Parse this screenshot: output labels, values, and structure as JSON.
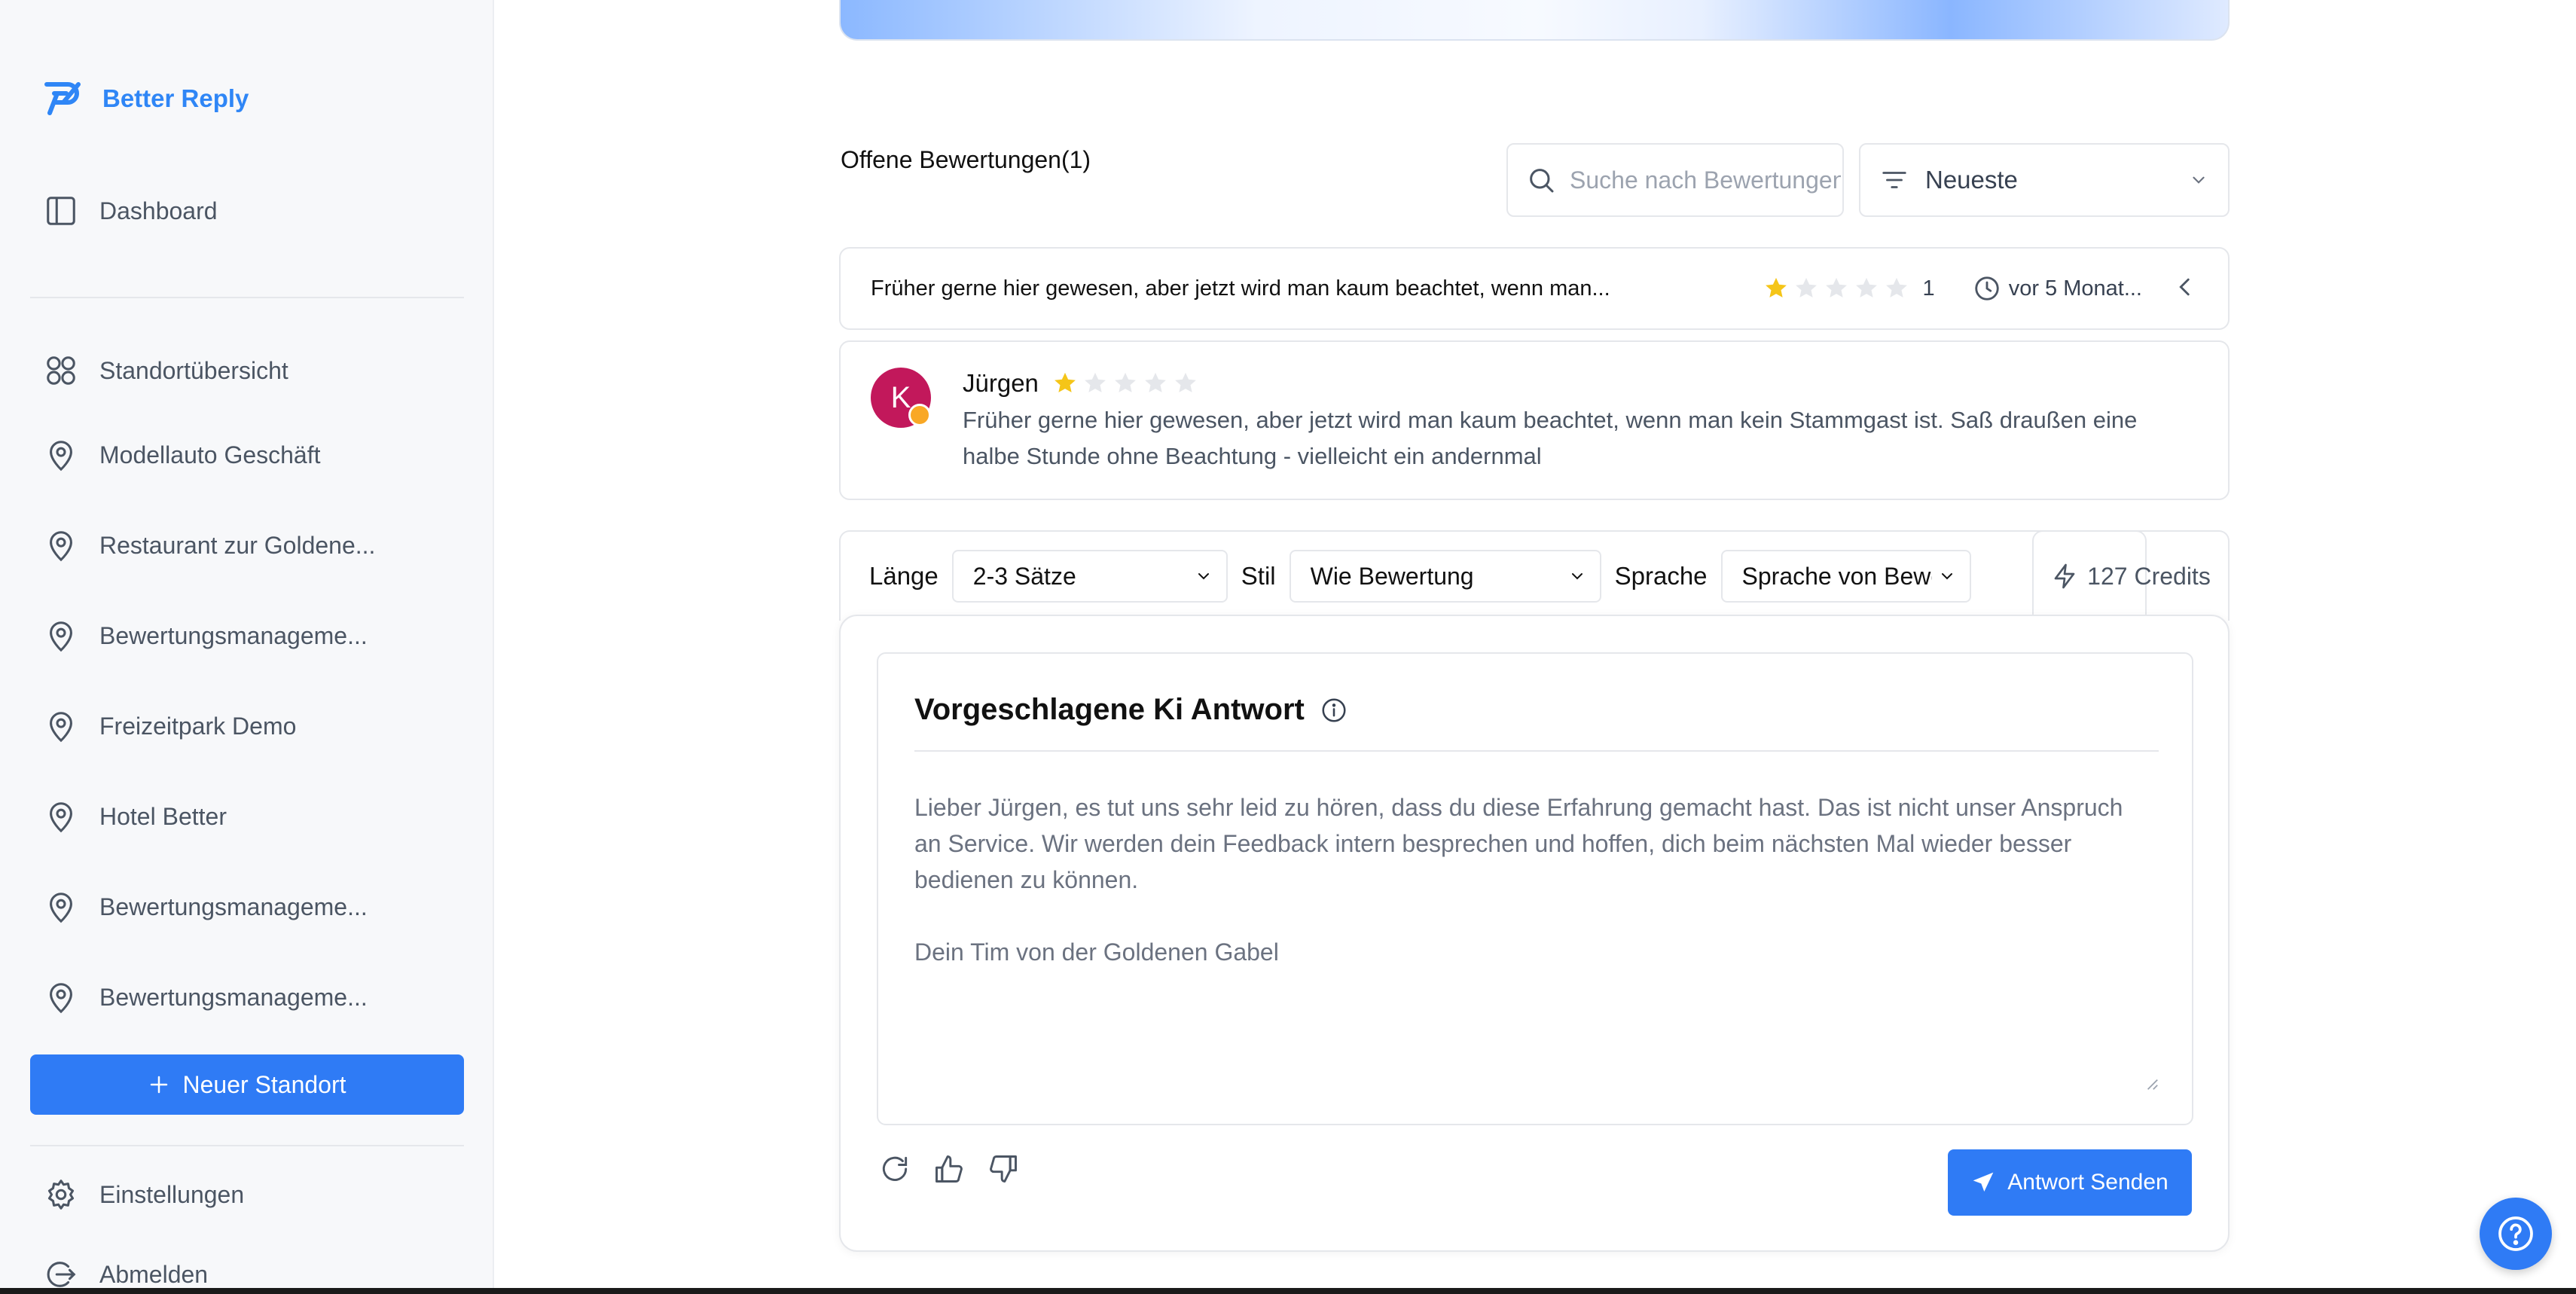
{
  "sidebar": {
    "brand": "Better Reply",
    "dashboard": "Dashboard",
    "overview": "Standortübersicht",
    "locations": [
      "Modellauto Geschäft",
      "Restaurant zur Goldene...",
      "Bewertungsmanageme...",
      "Freizeitpark Demo",
      "Hotel Better",
      "Bewertungsmanageme...",
      "Bewertungsmanageme..."
    ],
    "new_location": "Neuer Standort",
    "settings": "Einstellungen",
    "logout": "Abmelden"
  },
  "reviews": {
    "section_title": "Offene Bewertungen(1)",
    "search_placeholder": "Suche nach Bewertungen",
    "sort_value": "Neueste",
    "row": {
      "preview": "Früher gerne hier gewesen, aber jetzt wird man kaum beachtet, wenn man...",
      "rating": 1,
      "rating_max": 5,
      "count": "1",
      "time": "vor 5 Monat..."
    },
    "card": {
      "avatar_letter": "K",
      "reviewer": "Jürgen",
      "rating": 1,
      "text": "Früher gerne hier gewesen, aber jetzt wird man kaum beachtet, wenn man kein Stammgast ist. Saß draußen eine halbe Stunde ohne Beachtung - vielleicht ein andernmal"
    }
  },
  "options": {
    "length_label": "Länge",
    "length_value": "2-3 Sätze",
    "style_label": "Stil",
    "style_value": "Wie Bewertung",
    "language_label": "Sprache",
    "language_value": "Sprache von Bewertung",
    "credits": "127 Credits"
  },
  "answer": {
    "title": "Vorgeschlagene Ki Antwort",
    "text": "Lieber Jürgen, es tut uns sehr leid zu hören, dass du diese Erfahrung gemacht hast. Das ist nicht unser Anspruch an Service. Wir werden dein Feedback intern besprechen und hoffen, dich beim nächsten Mal wieder besser bedienen zu können.\n\nDein Tim von der Goldenen Gabel",
    "send_label": "Antwort Senden"
  },
  "colors": {
    "accent": "#2f7bf5",
    "star_filled": "#f5c518",
    "star_empty": "#e5e7eb",
    "avatar": "#c2185b"
  }
}
